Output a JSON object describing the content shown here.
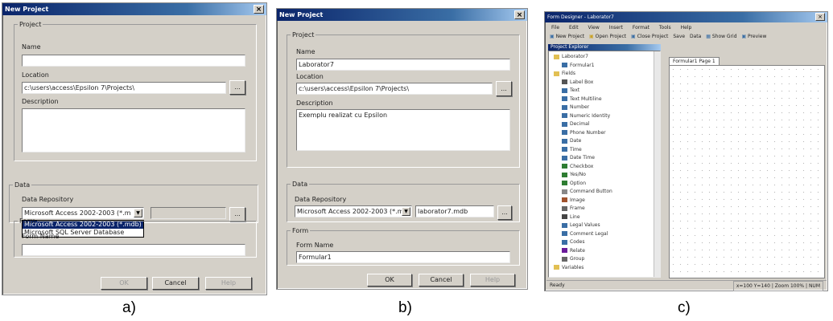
{
  "captions": {
    "a": "a)",
    "b": "b)",
    "c": "c)"
  },
  "dialog_a": {
    "title": "New Project",
    "close": "×",
    "project_legend": "Project",
    "name_label": "Name",
    "name_value": "",
    "location_label": "Location",
    "location_value": "c:\\users\\access\\Epsilon 7\\Projects\\",
    "browse": "...",
    "description_label": "Description",
    "description_value": "",
    "data_legend": "Data",
    "data_repository_label": "Data Repository",
    "data_repository_selected": "Microsoft Access 2002-2003 (*.m",
    "dropdown_options": [
      "Microsoft Access 2002-2003 (*.mdb)",
      "Microsoft SQL Server Database"
    ],
    "form_legend": "Form",
    "form_name_label": "Form Name",
    "form_name_value": "",
    "ok": "OK",
    "cancel": "Cancel",
    "help": "Help"
  },
  "dialog_b": {
    "title": "New Project",
    "close": "×",
    "project_legend": "Project",
    "name_label": "Name",
    "name_value": "Laborator7",
    "location_label": "Location",
    "location_value": "c:\\users\\access\\Epsilon 7\\Projects\\",
    "browse": "...",
    "description_label": "Description",
    "description_value": "Exemplu realizat cu Epsilon",
    "data_legend": "Data",
    "data_repository_label": "Data Repository",
    "data_repository_selected": "Microsoft Access 2002-2003 (*.m",
    "data_file_value": "laborator7.mdb",
    "form_legend": "Form",
    "form_name_label": "Form Name",
    "form_name_value": "Formular1",
    "ok": "OK",
    "cancel": "Cancel",
    "help": "Help"
  },
  "app_c": {
    "title": "Form Designer - Laborator7",
    "menu": [
      "File",
      "Edit",
      "View",
      "Insert",
      "Format",
      "Tools",
      "Help"
    ],
    "toolbar": [
      "New Project",
      "Open Project",
      "Close Project",
      "Save",
      "Data",
      "Show Grid",
      "Preview"
    ],
    "tree_header": "Project Explorer",
    "tree": [
      {
        "label": "Laborator7",
        "indent": 0,
        "icon": "folder"
      },
      {
        "label": "Formular1",
        "indent": 1,
        "icon": "form"
      },
      {
        "label": "Fields",
        "indent": 0,
        "icon": "folder"
      },
      {
        "label": "Label Box",
        "indent": 1,
        "icon": "label"
      },
      {
        "label": "Text",
        "indent": 1,
        "icon": "text"
      },
      {
        "label": "Text Multiline",
        "indent": 1,
        "icon": "text"
      },
      {
        "label": "Number",
        "indent": 1,
        "icon": "number"
      },
      {
        "label": "Numeric Identity",
        "indent": 1,
        "icon": "number"
      },
      {
        "label": "Decimal",
        "indent": 1,
        "icon": "number"
      },
      {
        "label": "Phone Number",
        "indent": 1,
        "icon": "phone"
      },
      {
        "label": "Date",
        "indent": 1,
        "icon": "date"
      },
      {
        "label": "Time",
        "indent": 1,
        "icon": "time"
      },
      {
        "label": "Date Time",
        "indent": 1,
        "icon": "date"
      },
      {
        "label": "Checkbox",
        "indent": 1,
        "icon": "check"
      },
      {
        "label": "Yes/No",
        "indent": 1,
        "icon": "check"
      },
      {
        "label": "Option",
        "indent": 1,
        "icon": "option"
      },
      {
        "label": "Command Button",
        "indent": 1,
        "icon": "button"
      },
      {
        "label": "Image",
        "indent": 1,
        "icon": "image"
      },
      {
        "label": "Frame",
        "indent": 1,
        "icon": "frame"
      },
      {
        "label": "Line",
        "indent": 1,
        "icon": "line"
      },
      {
        "label": "Legal Values",
        "indent": 1,
        "icon": "list"
      },
      {
        "label": "Comment Legal",
        "indent": 1,
        "icon": "list"
      },
      {
        "label": "Codes",
        "indent": 1,
        "icon": "list"
      },
      {
        "label": "Relate",
        "indent": 1,
        "icon": "relate"
      },
      {
        "label": "Group",
        "indent": 1,
        "icon": "group"
      },
      {
        "label": "Variables",
        "indent": 0,
        "icon": "folder"
      }
    ],
    "tab_label": "Formular1 Page 1",
    "status_left": "Ready",
    "status_right": "x=100  Y=140  |  Zoom 100%  |  NUM"
  },
  "colors": {
    "titlebar": "#0a246a",
    "window": "#d4d0c8",
    "selection": "#0a246a"
  }
}
